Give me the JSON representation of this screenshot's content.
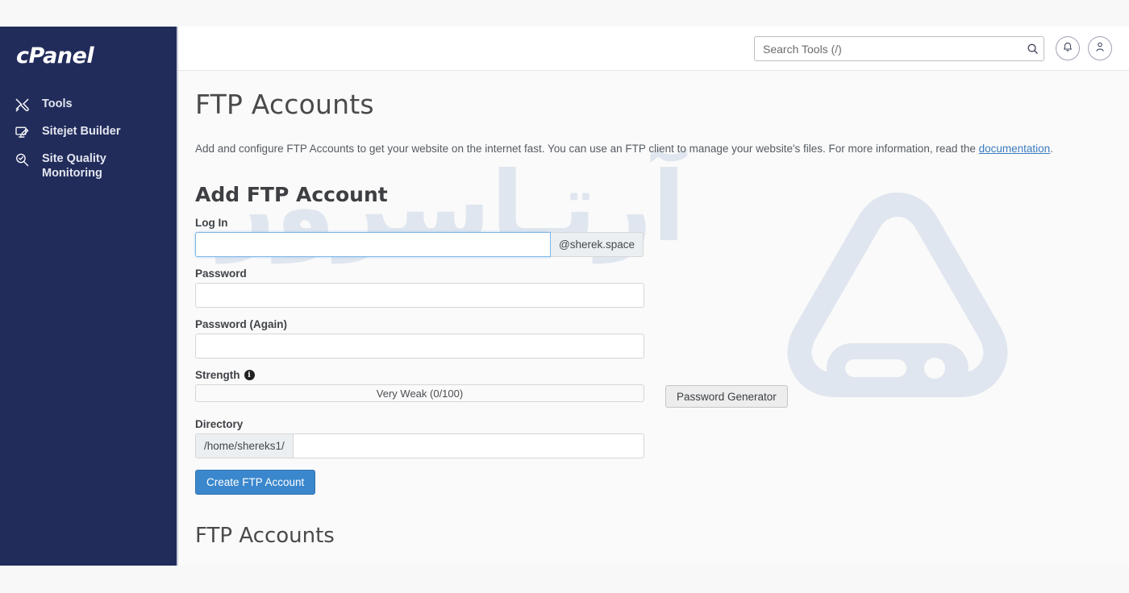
{
  "sidebar": {
    "brand": "cPanel",
    "items": [
      {
        "label": "Tools",
        "icon": "tools-icon"
      },
      {
        "label": "Sitejet Builder",
        "icon": "sitejet-builder-icon"
      },
      {
        "label": "Site Quality\nMonitoring",
        "icon": "site-quality-monitoring-icon"
      }
    ]
  },
  "header": {
    "search_placeholder": "Search Tools (/)",
    "search_value": "",
    "search_icon": "search-icon",
    "notifications_icon": "bell-icon",
    "account_icon": "user-icon"
  },
  "page": {
    "title": "FTP Accounts",
    "description_before": "Add and configure FTP Accounts to get your website on the internet fast. You can use an FTP client to manage your website's files. For more information, read the ",
    "description_link": "documentation",
    "description_after": ".",
    "watermark_text": "آرتـاسرور"
  },
  "add_form": {
    "heading": "Add FTP Account",
    "login": {
      "label": "Log In",
      "value": "",
      "domain_suffix": "@sherek.space",
      "focused": true
    },
    "password": {
      "label": "Password",
      "value": ""
    },
    "password_again": {
      "label": "Password (Again)",
      "value": ""
    },
    "strength": {
      "label": "Strength",
      "info_icon": "info-icon",
      "value_text": "Very Weak (0/100)",
      "score": 0,
      "max": 100,
      "generator_button": "Password Generator"
    },
    "directory": {
      "label": "Directory",
      "prefix": "/home/shereks1/",
      "value": ""
    },
    "submit_label": "Create FTP Account"
  },
  "accounts_section": {
    "heading": "FTP Accounts"
  },
  "colors": {
    "sidebar_bg": "#222c5b",
    "primary_button": "#3a87cd",
    "link": "#3a7bbf",
    "watermark": "#dfe5ef",
    "page_bg": "#fafafa"
  }
}
